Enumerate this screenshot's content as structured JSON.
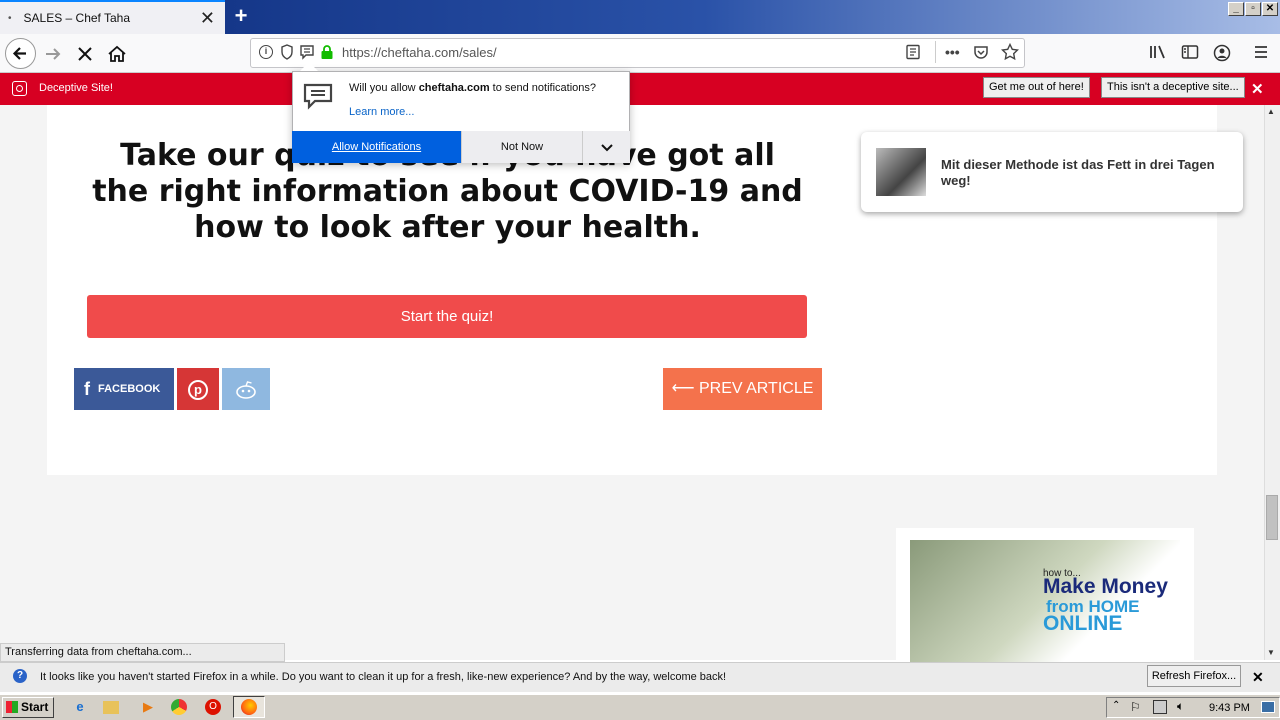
{
  "browser": {
    "tab_title": "SALES – Chef Taha",
    "tab_dot": "•",
    "tab_close": "✕",
    "new_tab": "+",
    "url": "https://cheftaha.com/sales/",
    "win_controls": [
      "_",
      "▫",
      "✕"
    ]
  },
  "deceptive_bar": {
    "text": "Deceptive Site!",
    "btn_get_out": "Get me out of here!",
    "btn_not_deceptive": "This isn't a deceptive site...",
    "close": "✕"
  },
  "popup": {
    "message_prefix": "Will you allow ",
    "message_domain": "cheftaha.com",
    "message_suffix": " to send notifications?",
    "learn_more": "Learn more...",
    "allow": "Allow Notifications",
    "not_now": "Not Now",
    "dropdown": "⌄"
  },
  "page": {
    "heading": "Take our quiz to see if you have got all the right information about COVID-19 and how to look after your health.",
    "quiz_button": "Start the quiz!",
    "facebook": "FACEBOOK",
    "prev_article": "⟵ PREV ARTICLE",
    "promo_text": "Mit dieser Methode ist das Fett in drei Tagen weg!",
    "ad_line1": "how to...",
    "ad_line2": "Make Money",
    "ad_line3": "from HOME",
    "ad_line4": "ONLINE"
  },
  "status": {
    "loading": "Transferring data from cheftaha.com...",
    "notification": "It looks like you haven't started Firefox in a while. Do you want to clean it up for a fresh, like-new experience? And by the way, welcome back!",
    "refresh_button": "Refresh Firefox...",
    "close": "✕"
  },
  "taskbar": {
    "start": "Start",
    "clock": "9:43 PM"
  }
}
